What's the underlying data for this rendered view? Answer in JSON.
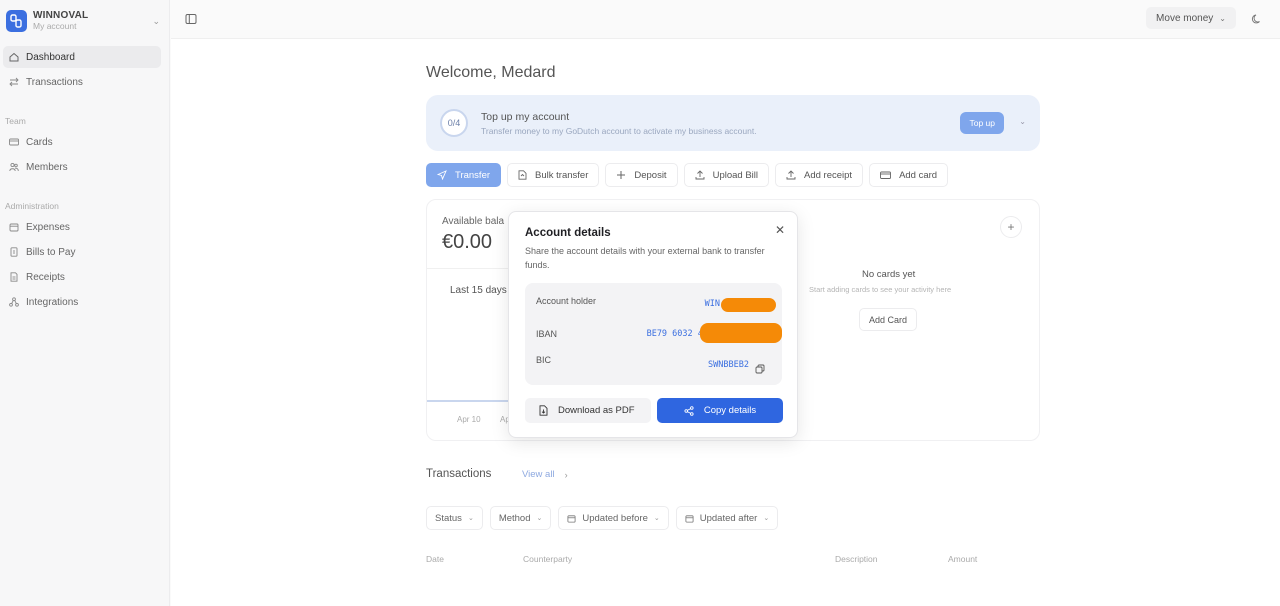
{
  "org": {
    "name": "WINNOVAL",
    "subtitle": "My account"
  },
  "sidebar": {
    "items": [
      {
        "label": "Dashboard",
        "icon": "home-icon"
      },
      {
        "label": "Transactions",
        "icon": "arrows-icon"
      }
    ],
    "team_label": "Team",
    "team_items": [
      {
        "label": "Cards",
        "icon": "card-icon"
      },
      {
        "label": "Members",
        "icon": "members-icon"
      }
    ],
    "admin_label": "Administration",
    "admin_items": [
      {
        "label": "Expenses",
        "icon": "calendar-icon"
      },
      {
        "label": "Bills to Pay",
        "icon": "bill-icon"
      },
      {
        "label": "Receipts",
        "icon": "receipt-icon"
      },
      {
        "label": "Integrations",
        "icon": "integrations-icon"
      }
    ]
  },
  "topbar": {
    "move_money": "Move money"
  },
  "main": {
    "welcome": "Welcome, Medard",
    "topup": {
      "progress": "0/4",
      "title": "Top up my account",
      "subtitle": "Transfer money to my GoDutch account to activate my business account.",
      "button": "Top up"
    },
    "actions": [
      "Transfer",
      "Bulk transfer",
      "Deposit",
      "Upload Bill",
      "Add receipt",
      "Add card"
    ],
    "balance": {
      "label": "Available bala",
      "value": "€0.00",
      "period": "Last 15 days",
      "axis": [
        "Apr 10",
        "Ap"
      ]
    },
    "cards": {
      "empty_title": "No cards yet",
      "empty_subtitle": "Start adding cards to see your activity here",
      "add_button": "Add Card"
    },
    "transactions": {
      "title": "Transactions",
      "view_all": "View all",
      "filters": [
        "Status",
        "Method",
        "Updated before",
        "Updated after"
      ],
      "columns": [
        "Date",
        "Counterparty",
        "Description",
        "Amount"
      ]
    }
  },
  "modal": {
    "title": "Account details",
    "description": "Share the account details with your external bank to transfer funds.",
    "fields": [
      {
        "label": "Account holder",
        "value": "WIN"
      },
      {
        "label": "IBAN",
        "value": "BE79 6032 40"
      },
      {
        "label": "BIC",
        "value": "SWNBBEB2"
      }
    ],
    "download_button": "Download as PDF",
    "copy_button": "Copy details"
  },
  "colors": {
    "accent": "#2f66e0",
    "accent_light": "#7fa6ec",
    "redaction": "#f58a07",
    "topup_bg": "#eaf0fa"
  }
}
